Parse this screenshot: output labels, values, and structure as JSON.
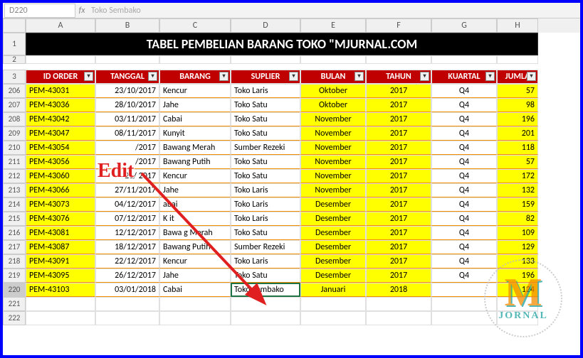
{
  "formula_bar": {
    "ref": "D220",
    "value": "Toko Sembako"
  },
  "columns": [
    "A",
    "B",
    "C",
    "D",
    "E",
    "F",
    "G",
    "H"
  ],
  "title": "TABEL PEMBELIAN BARANG TOKO \"MJURNAL.COM",
  "headers": {
    "a": "ID ORDER",
    "b": "TANGGAL",
    "c": "BARANG",
    "d": "SUPLIER",
    "e": "BULAN",
    "f": "TAHUN",
    "g": "KUARTAL",
    "h": "JUMLA"
  },
  "rows": [
    {
      "n": 206,
      "id": "PEM-43031",
      "tgl": "23/10/2017",
      "brg": "Kencur",
      "sup": "Toko Laris",
      "bln": "Oktober",
      "thn": "2017",
      "q": "Q4",
      "j": "57"
    },
    {
      "n": 207,
      "id": "PEM-43036",
      "tgl": "28/10/2017",
      "brg": "Jahe",
      "sup": "Toko Satu",
      "bln": "Oktober",
      "thn": "2017",
      "q": "Q4",
      "j": "98"
    },
    {
      "n": 208,
      "id": "PEM-43042",
      "tgl": "03/11/2017",
      "brg": "Cabai",
      "sup": "Toko Satu",
      "bln": "November",
      "thn": "2017",
      "q": "Q4",
      "j": "196"
    },
    {
      "n": 209,
      "id": "PEM-43047",
      "tgl": "08/11/2017",
      "brg": "Kunyit",
      "sup": "Toko Satu",
      "bln": "November",
      "thn": "2017",
      "q": "Q4",
      "j": "201"
    },
    {
      "n": 210,
      "id": "PEM-43054",
      "tgl": "/2017",
      "brg": "Bawang Merah",
      "sup": "Sumber Rezeki",
      "bln": "November",
      "thn": "2017",
      "q": "Q4",
      "j": "118"
    },
    {
      "n": 211,
      "id": "PEM-43056",
      "tgl": "/2017",
      "brg": "Bawang Putih",
      "sup": "Toko Satu",
      "bln": "November",
      "thn": "2017",
      "q": "Q4",
      "j": "57"
    },
    {
      "n": 212,
      "id": "PEM-43060",
      "tgl": "21/    2017",
      "brg": "Kencur",
      "sup": "Toko Satu",
      "bln": "November",
      "thn": "2017",
      "q": "Q4",
      "j": "172"
    },
    {
      "n": 213,
      "id": "PEM-43066",
      "tgl": "27/11/2017",
      "brg": "Jahe",
      "sup": "Toko Laris",
      "bln": "November",
      "thn": "2017",
      "q": "Q4",
      "j": "132"
    },
    {
      "n": 214,
      "id": "PEM-43073",
      "tgl": "04/12/2017",
      "brg": "abai",
      "sup": "Toko Laris",
      "bln": "Desember",
      "thn": "2017",
      "q": "Q4",
      "j": "159"
    },
    {
      "n": 215,
      "id": "PEM-43076",
      "tgl": "07/12/2017",
      "brg": "K    it",
      "sup": "Toko Laris",
      "bln": "Desember",
      "thn": "2017",
      "q": "Q4",
      "j": "82"
    },
    {
      "n": 216,
      "id": "PEM-43081",
      "tgl": "12/12/2017",
      "brg": "Bawa  g Merah",
      "sup": "Toko Satu",
      "bln": "Desember",
      "thn": "2017",
      "q": "Q4",
      "j": "109"
    },
    {
      "n": 217,
      "id": "PEM-43087",
      "tgl": "18/12/2017",
      "brg": "Bawang Putih",
      "sup": "Sumber Rezeki",
      "bln": "Desember",
      "thn": "2017",
      "q": "Q4",
      "j": "129"
    },
    {
      "n": 218,
      "id": "PEM-43091",
      "tgl": "22/12/2017",
      "brg": "Kencur",
      "sup": "Toko Laris",
      "bln": "Desember",
      "thn": "2017",
      "q": "Q4",
      "j": "133"
    },
    {
      "n": 219,
      "id": "PEM-43095",
      "tgl": "26/12/2017",
      "brg": "Jahe",
      "sup": "Toko Satu",
      "bln": "Desember",
      "thn": "2017",
      "q": "Q4",
      "j": "196"
    },
    {
      "n": 220,
      "id": "PEM-43103",
      "tgl": "03/01/2018",
      "brg": "Cabai",
      "sup": "Toko Sembako",
      "bln": "Januari",
      "thn": "2018",
      "q": "",
      "j": "124"
    }
  ],
  "blank_rows": [
    221,
    222
  ],
  "annotation": "Edit",
  "logo": {
    "m": "M",
    "t": "JORNAL"
  },
  "active": {
    "row": 220,
    "col": "D"
  }
}
